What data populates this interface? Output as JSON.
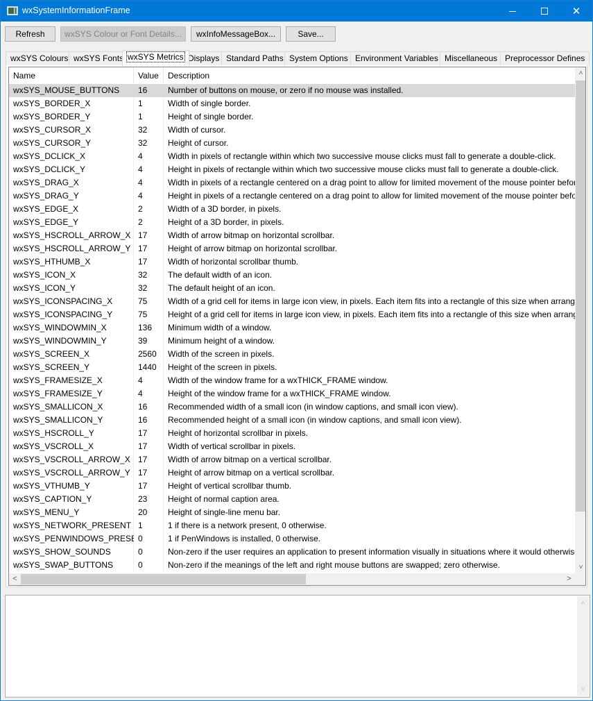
{
  "window": {
    "title": "wxSystemInformationFrame",
    "controls": {
      "minimize": "—",
      "maximize": "",
      "close": "✕"
    }
  },
  "toolbar": {
    "buttons": [
      {
        "label": "Refresh",
        "enabled": true
      },
      {
        "label": "wxSYS Colour or Font Details...",
        "enabled": false
      },
      {
        "label": "wxInfoMessageBox...",
        "enabled": true
      },
      {
        "label": "Save...",
        "enabled": true
      }
    ]
  },
  "tabs": [
    {
      "label": "wxSYS Colours",
      "active": false
    },
    {
      "label": "wxSYS Fonts",
      "active": false
    },
    {
      "label": "wxSYS Metrics",
      "active": true
    },
    {
      "label": "Displays",
      "active": false
    },
    {
      "label": "Standard Paths",
      "active": false
    },
    {
      "label": "System Options",
      "active": false
    },
    {
      "label": "Environment Variables",
      "active": false
    },
    {
      "label": "Miscellaneous",
      "active": false
    },
    {
      "label": "Preprocessor Defines",
      "active": false
    }
  ],
  "list": {
    "columns": [
      "Name",
      "Value",
      "Description"
    ],
    "selected_index": 0,
    "rows": [
      {
        "name": "wxSYS_MOUSE_BUTTONS",
        "value": "16",
        "desc": "Number of buttons on mouse, or zero if no mouse was installed."
      },
      {
        "name": "wxSYS_BORDER_X",
        "value": "1",
        "desc": "Width of single border."
      },
      {
        "name": "wxSYS_BORDER_Y",
        "value": "1",
        "desc": "Height of single border."
      },
      {
        "name": "wxSYS_CURSOR_X",
        "value": "32",
        "desc": "Width of cursor."
      },
      {
        "name": "wxSYS_CURSOR_Y",
        "value": "32",
        "desc": "Height of cursor."
      },
      {
        "name": "wxSYS_DCLICK_X",
        "value": "4",
        "desc": "Width in pixels of rectangle within which two successive mouse clicks must fall to generate a double-click."
      },
      {
        "name": "wxSYS_DCLICK_Y",
        "value": "4",
        "desc": "Height in pixels of rectangle within which two successive mouse clicks must fall to generate a double-click."
      },
      {
        "name": "wxSYS_DRAG_X",
        "value": "4",
        "desc": "Width in pixels of a rectangle centered on a drag point to allow for limited movement of the mouse pointer before"
      },
      {
        "name": "wxSYS_DRAG_Y",
        "value": "4",
        "desc": "Height in pixels of a rectangle centered on a drag point to allow for limited movement of the mouse pointer before"
      },
      {
        "name": "wxSYS_EDGE_X",
        "value": "2",
        "desc": "Width of a 3D border, in pixels."
      },
      {
        "name": "wxSYS_EDGE_Y",
        "value": "2",
        "desc": "Height of a 3D border, in pixels."
      },
      {
        "name": "wxSYS_HSCROLL_ARROW_X",
        "value": "17",
        "desc": "Width of arrow bitmap on horizontal scrollbar."
      },
      {
        "name": "wxSYS_HSCROLL_ARROW_Y",
        "value": "17",
        "desc": "Height of arrow bitmap on horizontal scrollbar."
      },
      {
        "name": "wxSYS_HTHUMB_X",
        "value": "17",
        "desc": "Width of horizontal scrollbar thumb."
      },
      {
        "name": "wxSYS_ICON_X",
        "value": "32",
        "desc": "The default width of an icon."
      },
      {
        "name": "wxSYS_ICON_Y",
        "value": "32",
        "desc": "The default height of an icon."
      },
      {
        "name": "wxSYS_ICONSPACING_X",
        "value": "75",
        "desc": "Width of a grid cell for items in large icon view, in pixels. Each item fits into a rectangle of this size when arranged."
      },
      {
        "name": "wxSYS_ICONSPACING_Y",
        "value": "75",
        "desc": "Height of a grid cell for items in large icon view, in pixels. Each item fits into a rectangle of this size when arranged."
      },
      {
        "name": "wxSYS_WINDOWMIN_X",
        "value": "136",
        "desc": "Minimum width of a window."
      },
      {
        "name": "wxSYS_WINDOWMIN_Y",
        "value": "39",
        "desc": "Minimum height of a window."
      },
      {
        "name": "wxSYS_SCREEN_X",
        "value": "2560",
        "desc": "Width of the screen in pixels."
      },
      {
        "name": "wxSYS_SCREEN_Y",
        "value": "1440",
        "desc": "Height of the screen in pixels."
      },
      {
        "name": "wxSYS_FRAMESIZE_X",
        "value": "4",
        "desc": "Width of the window frame for a wxTHICK_FRAME window."
      },
      {
        "name": "wxSYS_FRAMESIZE_Y",
        "value": "4",
        "desc": "Height of the window frame for a wxTHICK_FRAME window."
      },
      {
        "name": "wxSYS_SMALLICON_X",
        "value": "16",
        "desc": "Recommended width of a small icon (in window captions, and small icon view)."
      },
      {
        "name": "wxSYS_SMALLICON_Y",
        "value": "16",
        "desc": "Recommended height of a small icon (in window captions, and small icon view)."
      },
      {
        "name": "wxSYS_HSCROLL_Y",
        "value": "17",
        "desc": "Height of horizontal scrollbar in pixels."
      },
      {
        "name": "wxSYS_VSCROLL_X",
        "value": "17",
        "desc": "Width of vertical scrollbar in pixels."
      },
      {
        "name": "wxSYS_VSCROLL_ARROW_X",
        "value": "17",
        "desc": "Width of arrow bitmap on a vertical scrollbar."
      },
      {
        "name": "wxSYS_VSCROLL_ARROW_Y",
        "value": "17",
        "desc": "Height of arrow bitmap on a vertical scrollbar."
      },
      {
        "name": "wxSYS_VTHUMB_Y",
        "value": "17",
        "desc": "Height of vertical scrollbar thumb."
      },
      {
        "name": "wxSYS_CAPTION_Y",
        "value": "23",
        "desc": "Height of normal caption area."
      },
      {
        "name": "wxSYS_MENU_Y",
        "value": "20",
        "desc": "Height of single-line menu bar."
      },
      {
        "name": "wxSYS_NETWORK_PRESENT",
        "value": "1",
        "desc": "1 if there is a network present, 0 otherwise."
      },
      {
        "name": "wxSYS_PENWINDOWS_PRESENT",
        "value": "0",
        "desc": "1 if PenWindows is installed, 0 otherwise."
      },
      {
        "name": "wxSYS_SHOW_SOUNDS",
        "value": "0",
        "desc": "Non-zero if the user requires an application to present information visually in situations where it would otherwise"
      },
      {
        "name": "wxSYS_SWAP_BUTTONS",
        "value": "0",
        "desc": "Non-zero if the meanings of the left and right mouse buttons are swapped; zero otherwise."
      }
    ]
  },
  "scrollbars": {
    "arrow_up": "˄",
    "arrow_down": "˅",
    "arrow_left": "<",
    "arrow_right": ">"
  },
  "log": {
    "text": ""
  }
}
